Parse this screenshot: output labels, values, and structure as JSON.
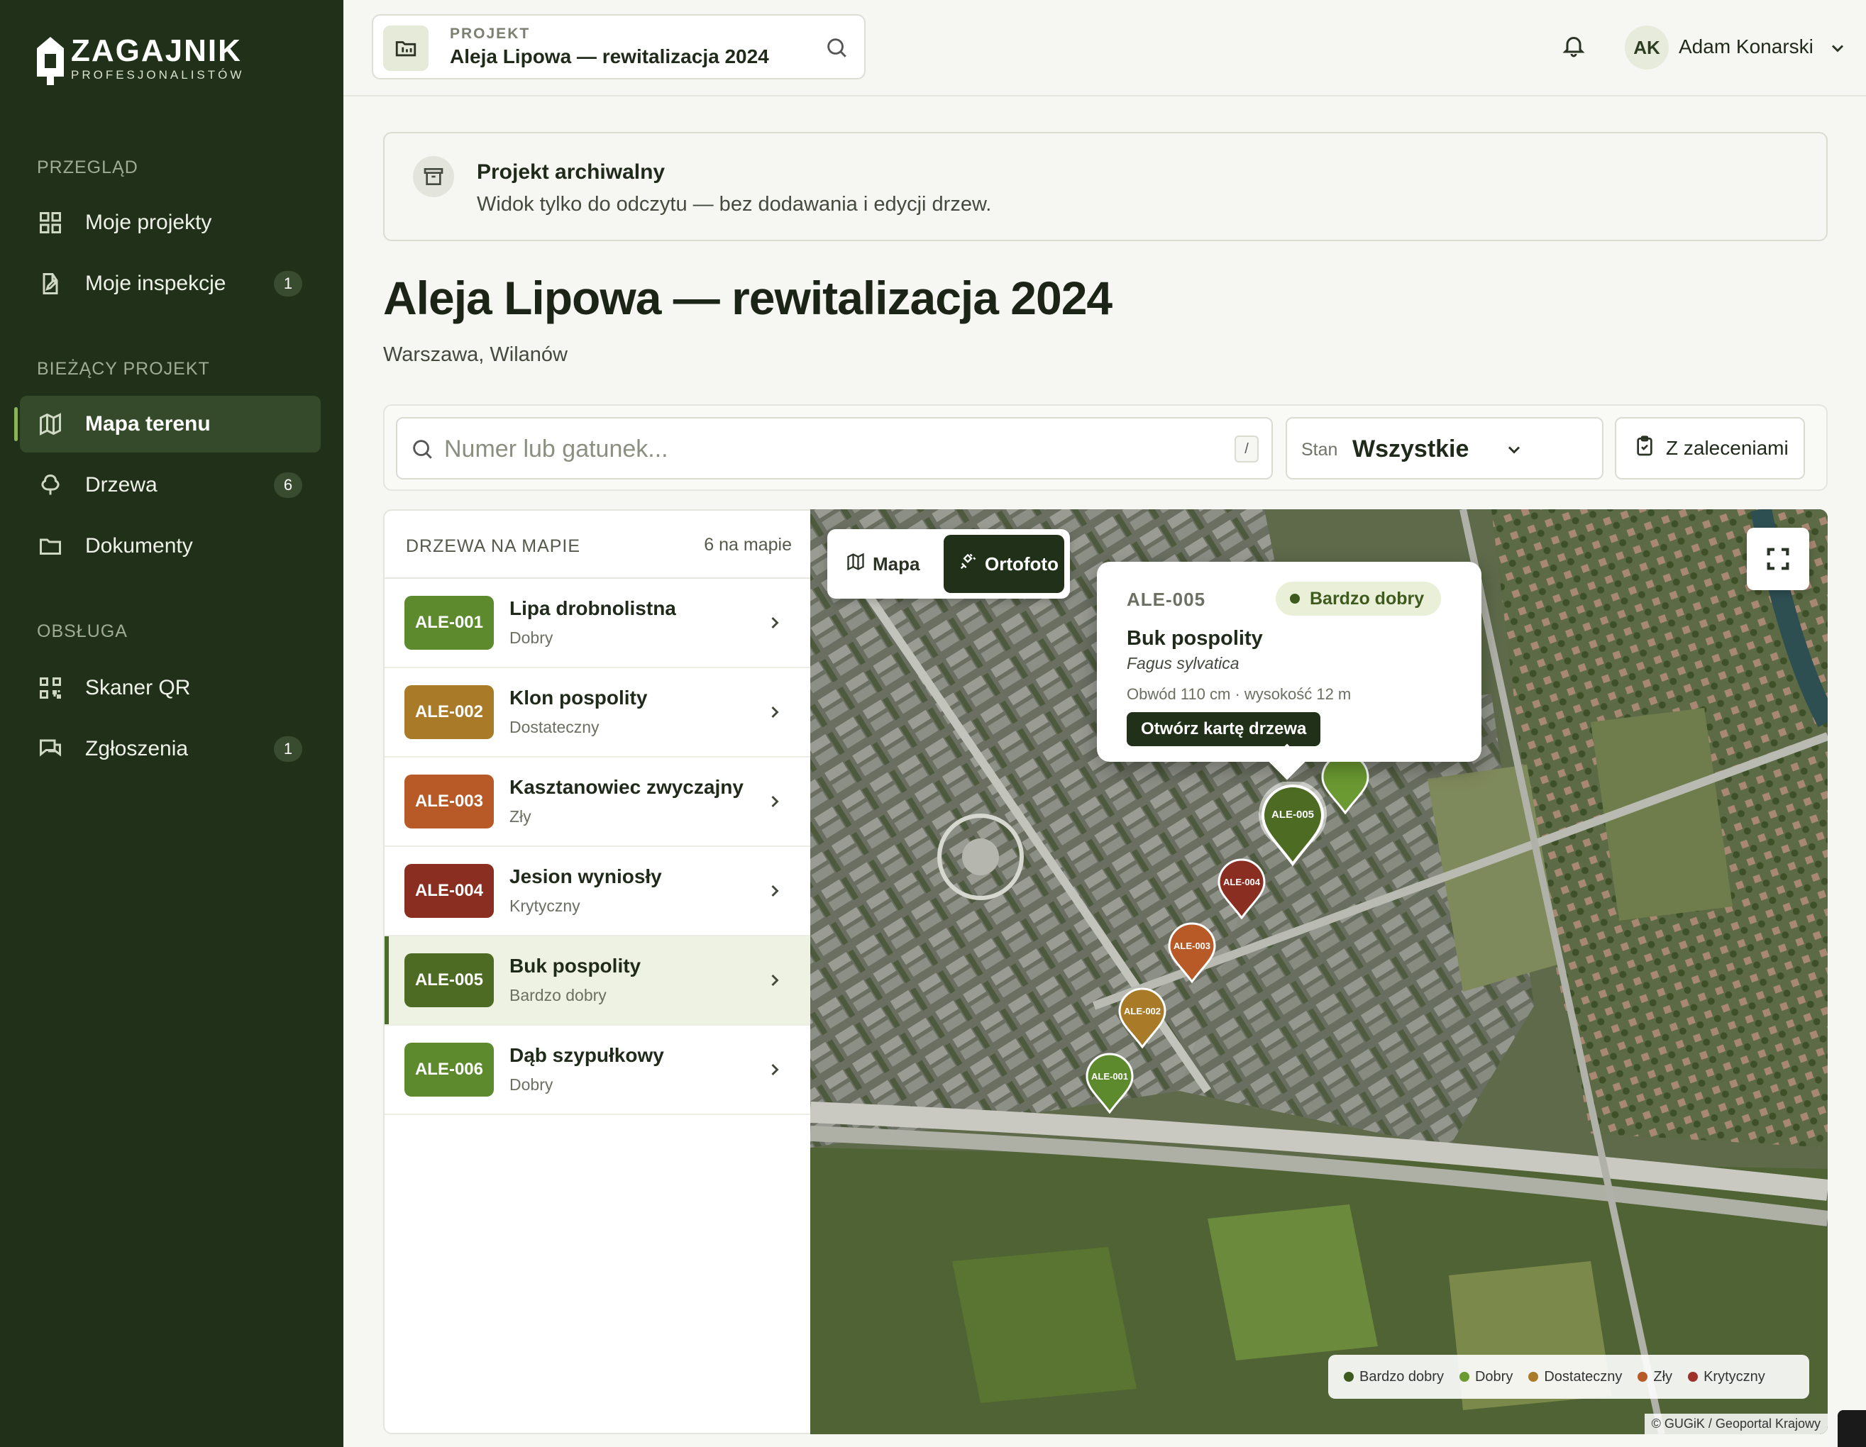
{
  "brand": {
    "title": "ZAGAJNIK",
    "subtitle": "PROFESJONALISTÓW"
  },
  "sidebar": {
    "sections": [
      {
        "label": "PRZEGLĄD",
        "items": [
          {
            "label": "Moje projekty",
            "icon": "grid-icon"
          },
          {
            "label": "Moje inspekcje",
            "icon": "edit-document-icon",
            "badge": "1"
          }
        ]
      },
      {
        "label": "BIEŻĄCY PROJEKT",
        "items": [
          {
            "label": "Mapa terenu",
            "icon": "map-icon",
            "active": true
          },
          {
            "label": "Drzewa",
            "icon": "tree-icon",
            "badge": "6"
          },
          {
            "label": "Dokumenty",
            "icon": "folder-icon"
          }
        ]
      },
      {
        "label": "OBSŁUGA",
        "items": [
          {
            "label": "Skaner QR",
            "icon": "qr-icon"
          },
          {
            "label": "Zgłoszenia",
            "icon": "chat-icon",
            "badge": "1"
          }
        ]
      }
    ]
  },
  "topbar": {
    "project_label": "PROJEKT",
    "project_title": "Aleja Lipowa — rewitalizacja 2024",
    "user_initials": "AK",
    "user_name": "Adam Konarski"
  },
  "banner": {
    "title": "Projekt archiwalny",
    "text": "Widok tylko do odczytu — bez dodawania i edycji drzew."
  },
  "page": {
    "title": "Aleja Lipowa — rewitalizacja 2024",
    "location": "Warszawa, Wilanów"
  },
  "filters": {
    "search_placeholder": "Numer lub gatunek...",
    "search_shortcut": "/",
    "state_label": "Stan",
    "state_value": "Wszystkie",
    "recommendations_label": "Z zaleceniami"
  },
  "list": {
    "title": "DRZEWA NA MAPIE",
    "count": "6 na mapie",
    "trees": [
      {
        "id": "ALE-001",
        "name": "Lipa drobnolistna",
        "state": "Dobry",
        "color": "#5e8a2e"
      },
      {
        "id": "ALE-002",
        "name": "Klon pospolity",
        "state": "Dostateczny",
        "color": "#a97a27"
      },
      {
        "id": "ALE-003",
        "name": "Kasztanowiec zwyczajny",
        "state": "Zły",
        "color": "#b85a27"
      },
      {
        "id": "ALE-004",
        "name": "Jesion wyniosły",
        "state": "Krytyczny",
        "color": "#8a2e22"
      },
      {
        "id": "ALE-005",
        "name": "Buk pospolity",
        "state": "Bardzo dobry",
        "color": "#4d6b22",
        "selected": true
      },
      {
        "id": "ALE-006",
        "name": "Dąb szypułkowy",
        "state": "Dobry",
        "color": "#5e8a2e"
      }
    ]
  },
  "map": {
    "mode_map": "Mapa",
    "mode_ortho": "Ortofoto",
    "popup": {
      "id": "ALE-005",
      "state": "Bardzo dobry",
      "name": "Buk pospolity",
      "latin": "Fagus sylvatica",
      "dims": "Obwód 110 cm · wysokość 12 m",
      "button": "Otwórz kartę drzewa"
    },
    "pins": [
      {
        "label": "ALE-001",
        "color": "#5e8a2e"
      },
      {
        "label": "ALE-002",
        "color": "#a97a27"
      },
      {
        "label": "ALE-003",
        "color": "#b85a27"
      },
      {
        "label": "ALE-004",
        "color": "#8a2e22"
      },
      {
        "label": "ALE-005",
        "color": "#4d6b22"
      }
    ],
    "legend": [
      {
        "label": "Bardzo dobry",
        "color": "#3e5a1e"
      },
      {
        "label": "Dobry",
        "color": "#6c9a32"
      },
      {
        "label": "Dostateczny",
        "color": "#a97a27"
      },
      {
        "label": "Zły",
        "color": "#b85a27"
      },
      {
        "label": "Krytyczny",
        "color": "#a0302a"
      }
    ],
    "attribution": "© GUGiK / Geoportal Krajowy"
  }
}
